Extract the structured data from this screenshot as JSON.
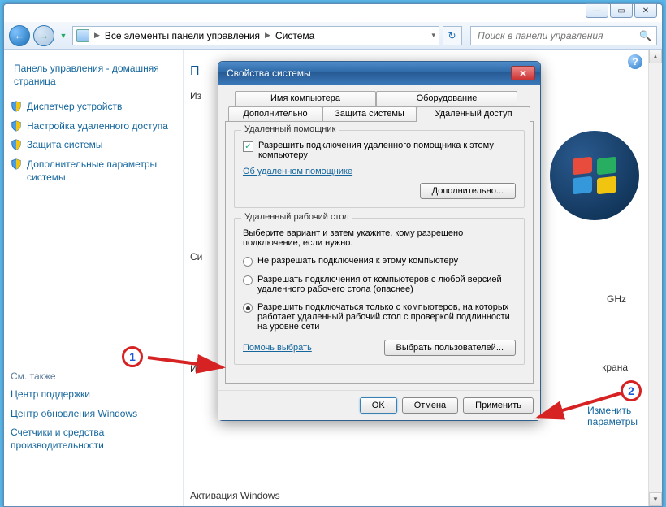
{
  "titlebar": {
    "min": "—",
    "max": "▭",
    "close": "✕"
  },
  "nav": {
    "crumb1": "Все элементы панели управления",
    "crumb2": "Система",
    "search_placeholder": "Поиск в панели управления"
  },
  "sidebar": {
    "home": "Панель управления - домашняя страница",
    "links": [
      "Диспетчер устройств",
      "Настройка удаленного доступа",
      "Защита системы",
      "Дополнительные параметры системы"
    ],
    "seealso_hdr": "См. также",
    "seealso": [
      "Центр поддержки",
      "Центр обновления Windows",
      "Счетчики и средства производительности"
    ]
  },
  "main": {
    "heading_cut1": "П",
    "heading_cut2": "Из",
    "snip1": "Си",
    "snip2": "И",
    "ghz": "GHz",
    "krana": "крана",
    "change": "Изменить",
    "params": "параметры",
    "activation": "Активация Windows"
  },
  "dialog": {
    "title": "Свойства системы",
    "tabs": {
      "t1": "Имя компьютера",
      "t2": "Оборудование",
      "t3": "Дополнительно",
      "t4": "Защита системы",
      "t5": "Удаленный доступ"
    },
    "group1": {
      "legend": "Удаленный помощник",
      "chk_label": "Разрешить подключения удаленного помощника к этому компьютеру",
      "link": "Об удаленном помощнике",
      "btn": "Дополнительно..."
    },
    "group2": {
      "legend": "Удаленный рабочий стол",
      "desc": "Выберите вариант и затем укажите, кому разрешено подключение, если нужно.",
      "r1": "Не разрешать подключения к этому компьютеру",
      "r2": "Разрешать подключения от компьютеров с любой версией удаленного рабочего стола (опаснее)",
      "r3": "Разрешить подключаться только с компьютеров, на которых работает удаленный рабочий стол с проверкой подлинности на уровне сети",
      "help": "Помочь выбрать",
      "select_users": "Выбрать пользователей..."
    },
    "footer": {
      "ok": "OK",
      "cancel": "Отмена",
      "apply": "Применить"
    }
  },
  "anno": {
    "one": "1",
    "two": "2"
  }
}
